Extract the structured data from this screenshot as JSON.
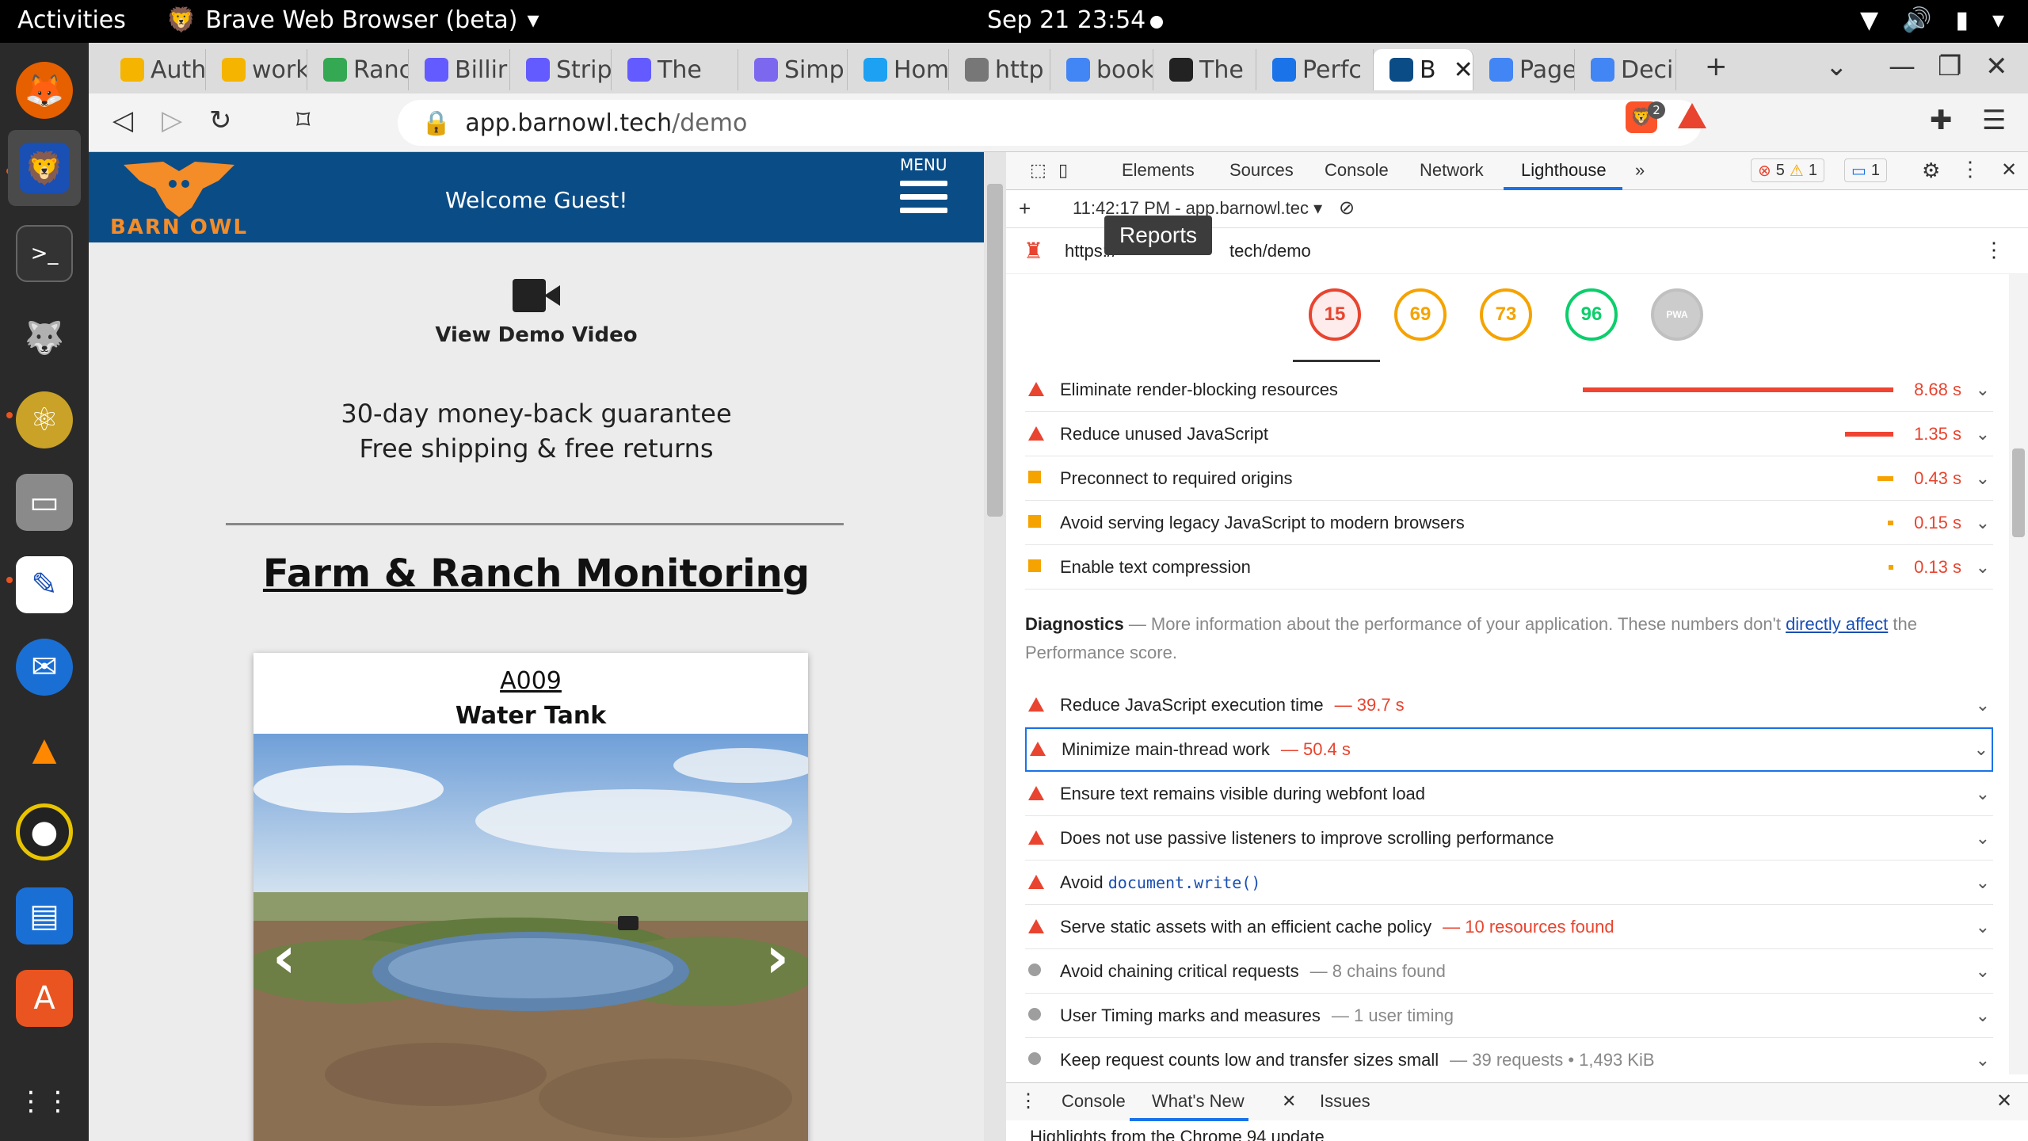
{
  "topbar": {
    "activities": "Activities",
    "app_name": "Brave Web Browser (beta)",
    "datetime": "Sep 21  23:54"
  },
  "dock": {
    "apps": [
      "Firefox",
      "Brave Browser (beta)",
      "Terminal",
      "GIMP",
      "Atom",
      "Files",
      "Text Editor",
      "Thunderbird",
      "VLC",
      "Rhythmbox",
      "LibreOffice Writer",
      "Ubuntu Software",
      "Show Applications"
    ]
  },
  "tabs": [
    {
      "title": "Auth",
      "color": "#f4b400"
    },
    {
      "title": "work",
      "color": "#f4b400"
    },
    {
      "title": "Ranc",
      "color": "#34a853"
    },
    {
      "title": "Billir",
      "color": "#635bff"
    },
    {
      "title": "Strip",
      "color": "#635bff"
    },
    {
      "title": "The",
      "color": "#635bff"
    },
    {
      "title": "Simp",
      "color": "#7b68ee"
    },
    {
      "title": "Hom",
      "color": "#1da1f2"
    },
    {
      "title": "http",
      "color": "#777777"
    },
    {
      "title": "book",
      "color": "#4285f4"
    },
    {
      "title": "The",
      "color": "#222222"
    },
    {
      "title": "Perfc",
      "color": "#1a73e8"
    },
    {
      "title": "B",
      "color": "#0a4c86"
    },
    {
      "title": "Page",
      "color": "#4285f4"
    },
    {
      "title": "Deci",
      "color": "#4285f4"
    }
  ],
  "toolbar": {
    "url_host": "app.barnowl.tech",
    "url_path": "/demo",
    "shield_count": "2"
  },
  "page": {
    "brand": "BARN OWL",
    "welcome": "Welcome Guest!",
    "menu_label": "MENU",
    "demo_video": "View Demo Video",
    "guarantee_line1": "30-day money-back guarantee",
    "guarantee_line2": "Free shipping & free returns",
    "section_title": "Farm & Ranch Monitoring",
    "card_code": "A009",
    "card_name": "Water Tank"
  },
  "devtools": {
    "tabs": [
      "Elements",
      "Sources",
      "Console",
      "Network",
      "Lighthouse"
    ],
    "active_tab": "Lighthouse",
    "more": "»",
    "errors": "5",
    "warnings": "1",
    "messages": "1",
    "report_time": "11:42:17 PM - app.barnowl.tec",
    "tooltip": "Reports",
    "report_url": "https://app.barnowl.tech/demo",
    "report_url_prefix": "https://",
    "report_url_suffix": "tech/demo",
    "scores": [
      {
        "value": "15",
        "color": "#e8442f"
      },
      {
        "value": "69",
        "color": "#f5a300"
      },
      {
        "value": "73",
        "color": "#f5a300"
      },
      {
        "value": "96",
        "color": "#0cce6b"
      },
      {
        "value": "PWA",
        "color": "#c0c0c0"
      }
    ],
    "opportunities": [
      {
        "title": "Eliminate render-blocking resources",
        "metric": "8.68 s",
        "severity": "fail",
        "bar": 1.0
      },
      {
        "title": "Reduce unused JavaScript",
        "metric": "1.35 s",
        "severity": "fail",
        "bar": 0.156
      },
      {
        "title": "Preconnect to required origins",
        "metric": "0.43 s",
        "severity": "average",
        "bar": 0.05
      },
      {
        "title": "Avoid serving legacy JavaScript to modern browsers",
        "metric": "0.15 s",
        "severity": "average",
        "bar": 0.017
      },
      {
        "title": "Enable text compression",
        "metric": "0.13 s",
        "severity": "average",
        "bar": 0.015
      }
    ],
    "diagnostics": {
      "heading": "Diagnostics",
      "text_before": " — More information about the performance of your application. These numbers don't ",
      "link": "directly affect",
      "text_after": " the Performance score."
    },
    "diag_items": [
      {
        "title": "Reduce JavaScript execution time",
        "detail": "— 39.7 s",
        "severity": "fail"
      },
      {
        "title": "Minimize main-thread work",
        "detail": "— 50.4 s",
        "severity": "fail"
      },
      {
        "title": "Ensure text remains visible during webfont load",
        "detail": "",
        "severity": "fail"
      },
      {
        "title": "Does not use passive listeners to improve scrolling performance",
        "detail": "",
        "severity": "fail"
      },
      {
        "title": "Avoid ",
        "code": "document.write()",
        "detail": "",
        "severity": "fail"
      },
      {
        "title": "Serve static assets with an efficient cache policy",
        "detail": "— 10 resources found",
        "severity": "fail"
      },
      {
        "title": "Avoid chaining critical requests",
        "detail": "— 8 chains found",
        "severity": "info"
      },
      {
        "title": "User Timing marks and measures",
        "detail": "— 1 user timing",
        "severity": "info"
      },
      {
        "title": "Keep request counts low and transfer sizes small",
        "detail": "— 39 requests • 1,493 KiB",
        "severity": "info"
      }
    ],
    "drawer_tabs": [
      "Console",
      "What's New",
      "Issues"
    ],
    "drawer_text": "Highlights from the Chrome 94 update"
  }
}
